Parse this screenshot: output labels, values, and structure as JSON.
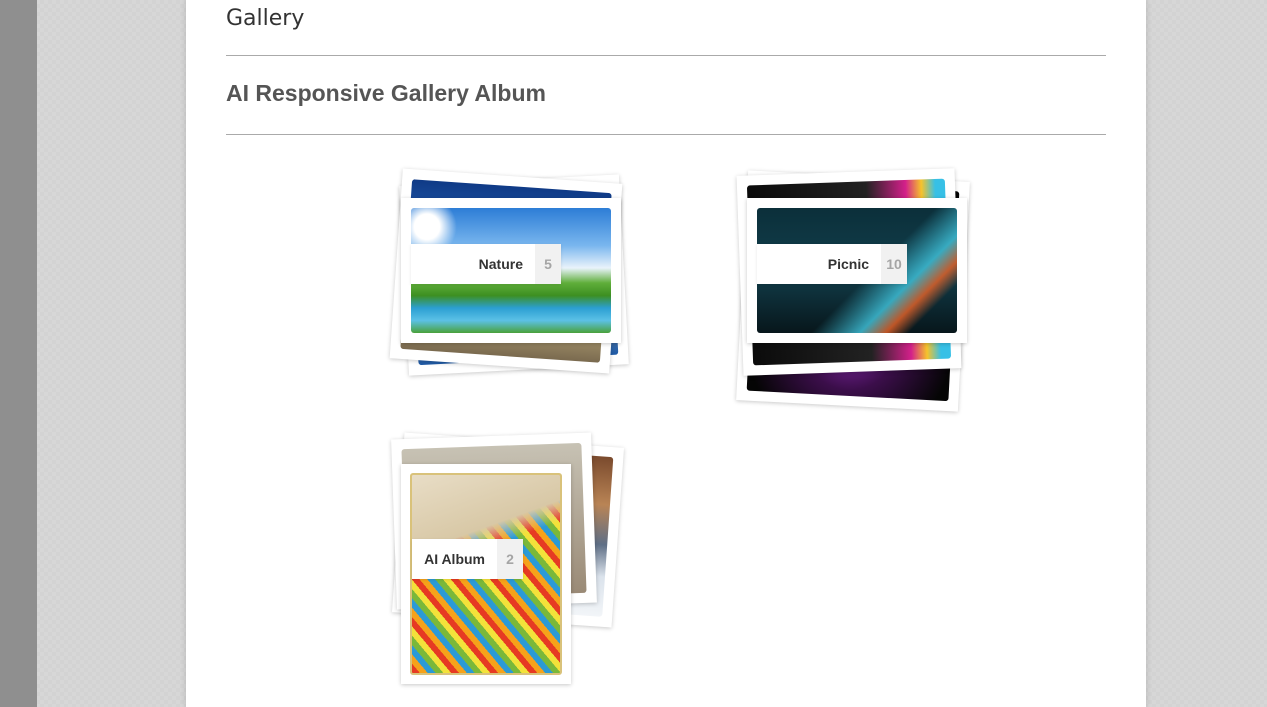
{
  "page": {
    "section_title": "Gallery",
    "album_heading": "AI Responsive Gallery Album"
  },
  "albums": [
    {
      "name": "Nature",
      "count": "5"
    },
    {
      "name": "Picnic",
      "count": "10"
    },
    {
      "name": "AI Album",
      "count": "2"
    }
  ],
  "colors": {
    "page_background": "#d3d3d3",
    "left_strip": "#8f8f8f",
    "content_background": "#ffffff",
    "heading_text": "#555555",
    "count_text": "#a5a5a5"
  }
}
